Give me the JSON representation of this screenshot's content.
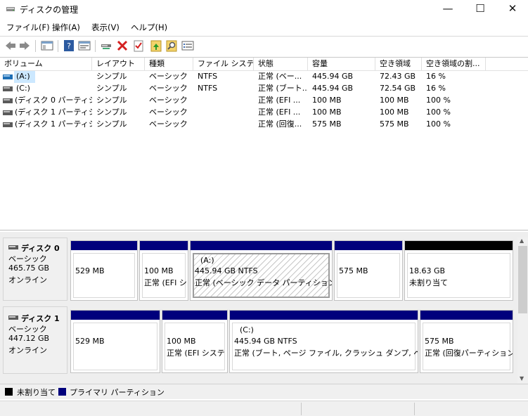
{
  "window": {
    "title": "ディスクの管理",
    "controls": {
      "minimize": "—",
      "maximize": "☐",
      "close": "✕"
    }
  },
  "menu": [
    "ファイル(F)",
    "操作(A)",
    "表示(V)",
    "ヘルプ(H)"
  ],
  "toolbar_icons": [
    "back-icon",
    "forward-icon",
    "console-tree-icon",
    "help-icon",
    "properties-icon",
    "connect-icon",
    "delete-icon",
    "checkmark-icon",
    "import-icon",
    "search-icon",
    "list-icon"
  ],
  "volume_list": {
    "columns": [
      "ボリューム",
      "レイアウト",
      "種類",
      "ファイル システム",
      "状態",
      "容量",
      "空き領域",
      "空き領域の割..."
    ],
    "rows": [
      [
        "(A:)",
        "シンプル",
        "ベーシック",
        "NTFS",
        "正常 (ベー...",
        "445.94 GB",
        "72.43 GB",
        "16 %"
      ],
      [
        "(C:)",
        "シンプル",
        "ベーシック",
        "NTFS",
        "正常 (ブート...",
        "445.94 GB",
        "72.54 GB",
        "16 %"
      ],
      [
        "(ディスク 0 パーティシ...",
        "シンプル",
        "ベーシック",
        "",
        "正常 (EFI ...",
        "100 MB",
        "100 MB",
        "100 %"
      ],
      [
        "(ディスク 1 パーティシ...",
        "シンプル",
        "ベーシック",
        "",
        "正常 (EFI ...",
        "100 MB",
        "100 MB",
        "100 %"
      ],
      [
        "(ディスク 1 パーティシ...",
        "シンプル",
        "ベーシック",
        "",
        "正常 (回復...",
        "575 MB",
        "575 MB",
        "100 %"
      ]
    ]
  },
  "disks": [
    {
      "name": "ディスク 0",
      "type": "ベーシック",
      "size": "465.75 GB",
      "status": "オンライン",
      "partitions": [
        {
          "line1": "",
          "line2": "529 MB",
          "line3": ""
        },
        {
          "line1": "",
          "line2": "100 MB",
          "line3": "正常 (EFI シ"
        },
        {
          "line1": "(A:)",
          "line2": "445.94 GB NTFS",
          "line3": "正常 (ベーシック データ パーティション)"
        },
        {
          "line1": "",
          "line2": "575 MB",
          "line3": ""
        },
        {
          "line1": "",
          "line2": "18.63 GB",
          "line3": "未割り当て"
        }
      ]
    },
    {
      "name": "ディスク 1",
      "type": "ベーシック",
      "size": "447.12 GB",
      "status": "オンライン",
      "partitions": [
        {
          "line1": "",
          "line2": "529 MB",
          "line3": ""
        },
        {
          "line1": "",
          "line2": "100 MB",
          "line3": "正常 (EFI システ"
        },
        {
          "line1": "(C:)",
          "line2": "445.94 GB NTFS",
          "line3": "正常 (ブート, ページ ファイル, クラッシュ ダンプ, ベーシック"
        },
        {
          "line1": "",
          "line2": "575 MB",
          "line3": "正常 (回復パーティション)"
        }
      ]
    }
  ],
  "legend": {
    "unallocated": "未割り当て",
    "primary": "プライマリ パーティション"
  },
  "colors": {
    "primary": "#00007c",
    "unallocated": "#000000",
    "selection": "#cce8ff"
  }
}
